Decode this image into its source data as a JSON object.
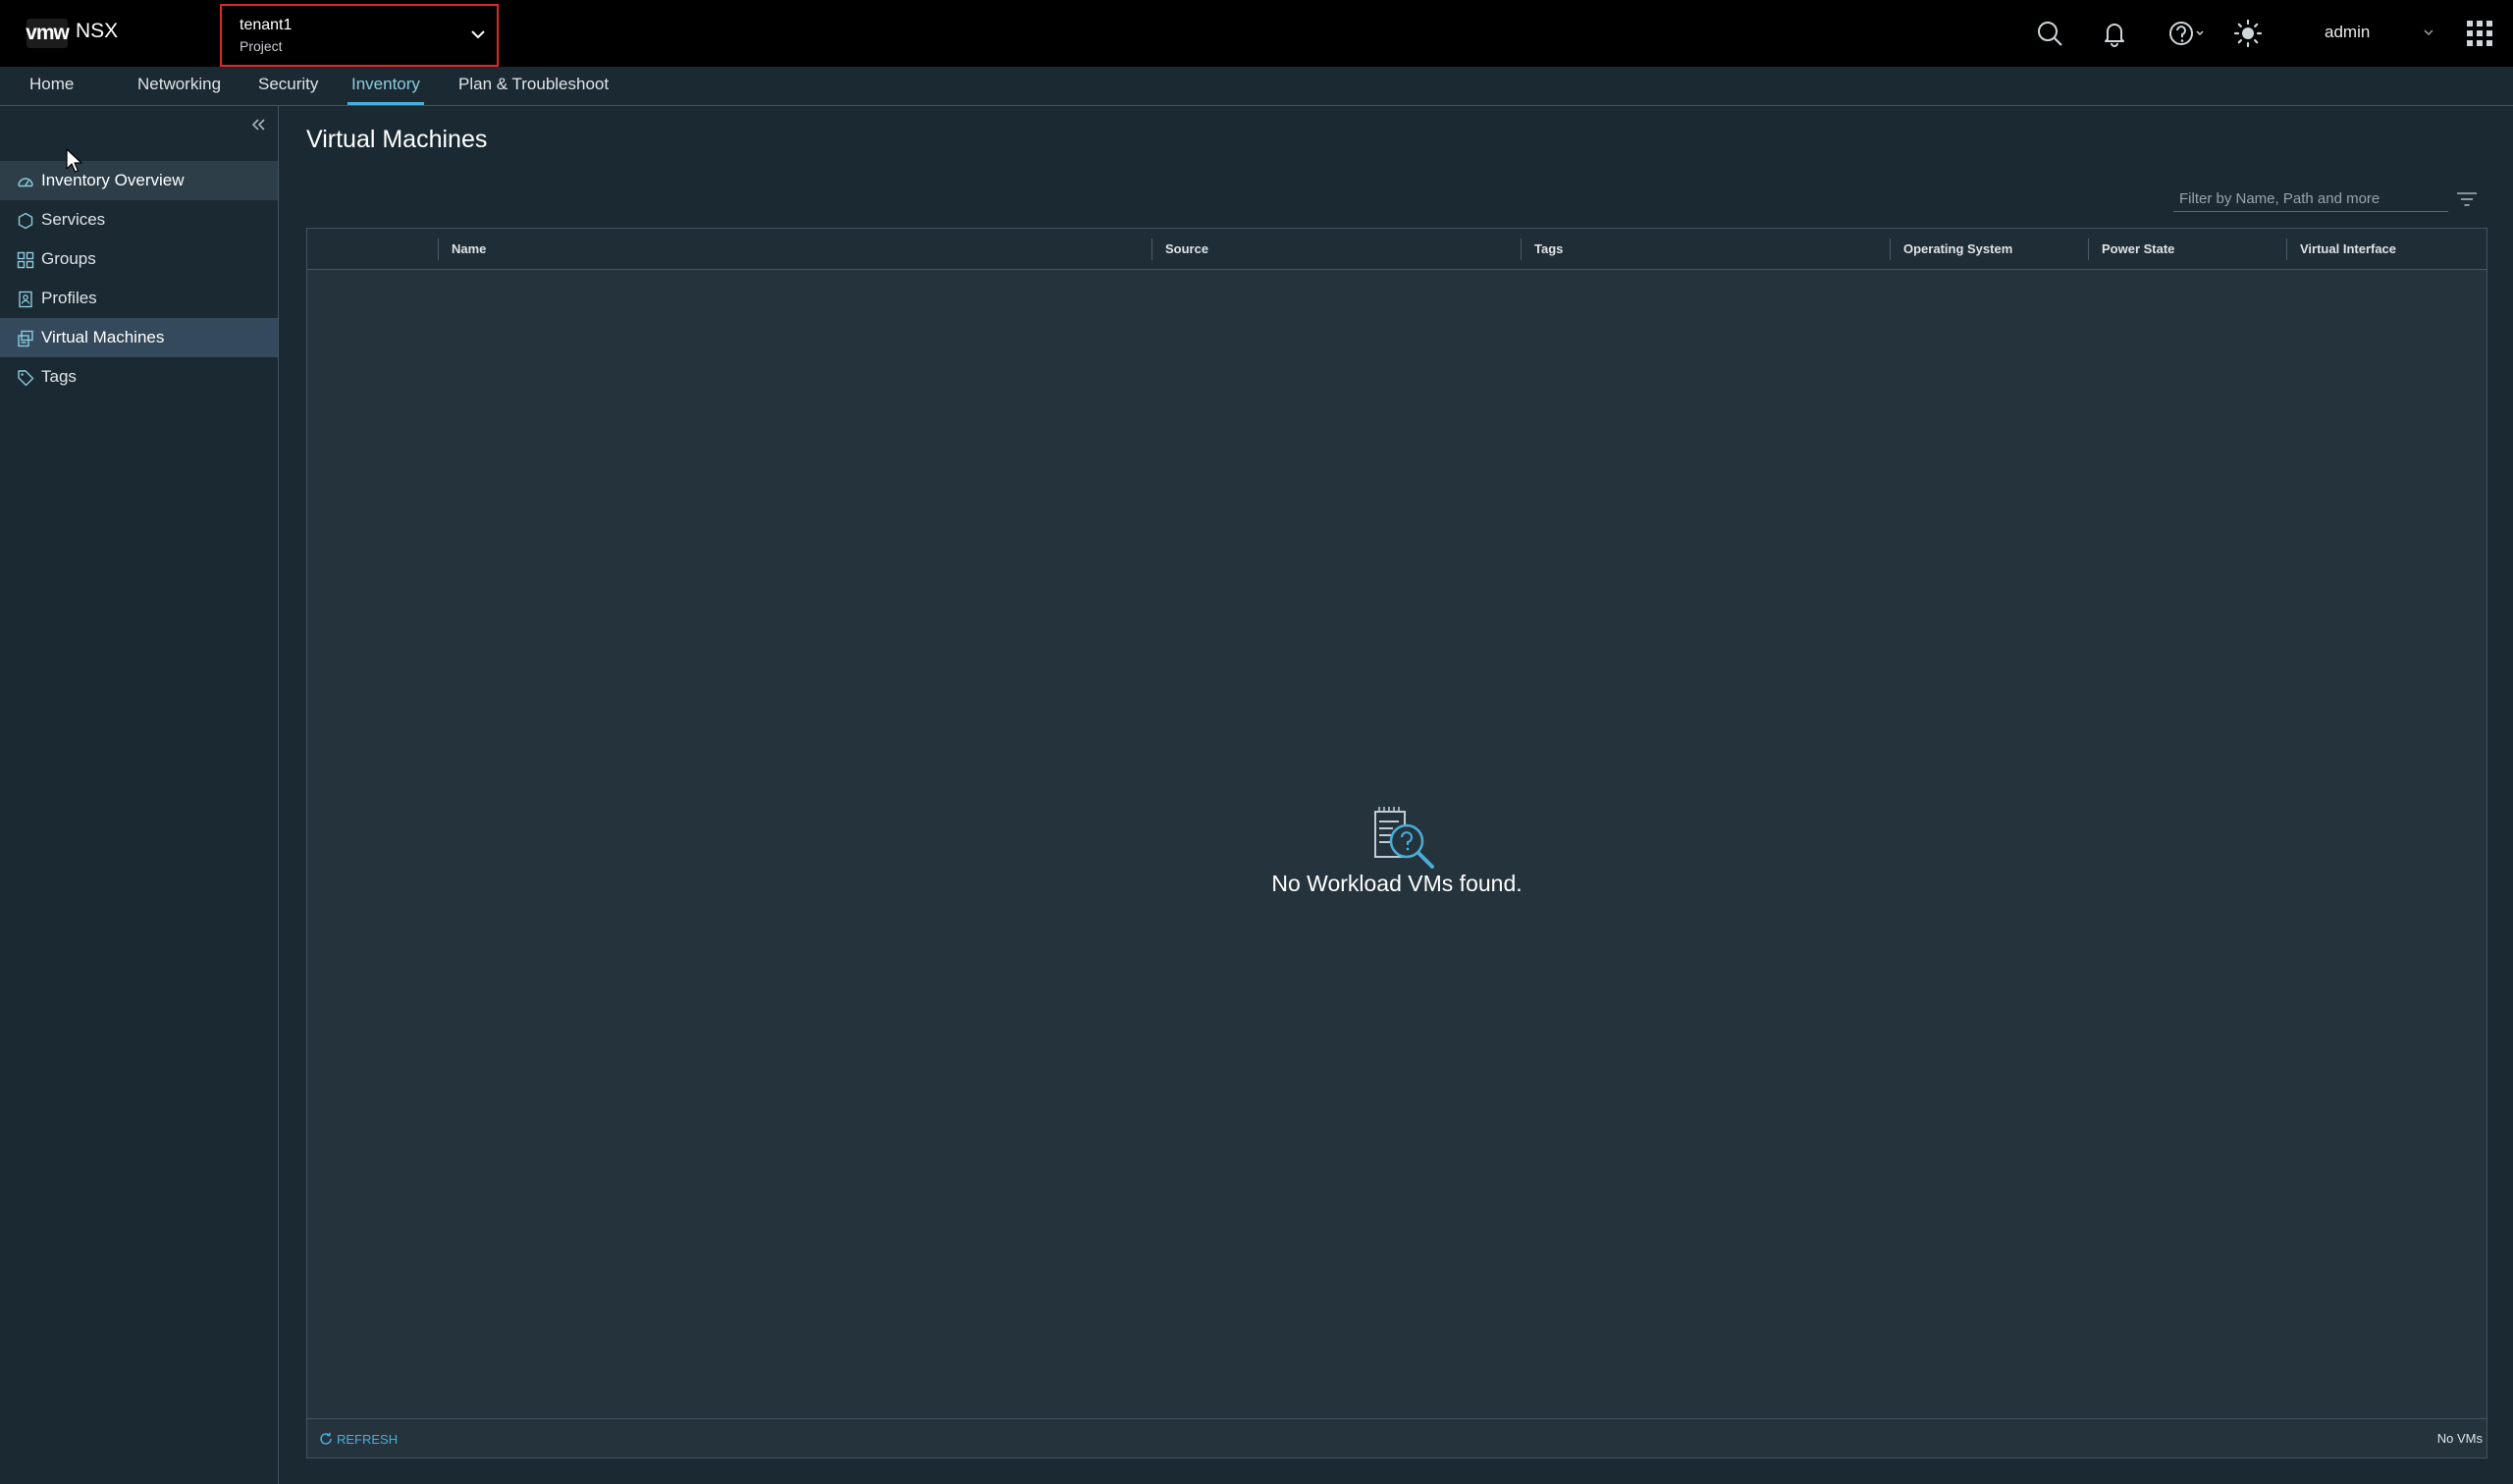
{
  "header": {
    "logo": "vmw",
    "product": "NSX",
    "project": {
      "name": "tenant1",
      "type": "Project"
    },
    "icons": [
      "search-icon",
      "bell-icon",
      "help-icon",
      "theme-sun-icon",
      "apps-grid-icon"
    ],
    "user": "admin"
  },
  "nav": {
    "tabs": [
      {
        "label": "Home"
      },
      {
        "label": "Networking"
      },
      {
        "label": "Security"
      },
      {
        "label": "Inventory",
        "active": true
      },
      {
        "label": "Plan & Troubleshoot"
      }
    ]
  },
  "sidebar": {
    "items": [
      {
        "label": "Inventory Overview",
        "icon": "dashboard-icon"
      },
      {
        "label": "Services",
        "icon": "services-icon"
      },
      {
        "label": "Groups",
        "icon": "groups-icon"
      },
      {
        "label": "Profiles",
        "icon": "profiles-icon"
      },
      {
        "label": "Virtual Machines",
        "icon": "vm-icon",
        "active": true
      },
      {
        "label": "Tags",
        "icon": "tag-icon"
      }
    ]
  },
  "main": {
    "title": "Virtual Machines",
    "filter_placeholder": "Filter by Name, Path and more",
    "columns": [
      "Name",
      "Source",
      "Tags",
      "Operating System",
      "Power State",
      "Virtual Interface"
    ],
    "empty_message": "No Workload VMs found.",
    "refresh_label": "REFRESH",
    "count_label": "No VMs"
  },
  "colors": {
    "accent": "#49afd9",
    "background": "#1b2a32",
    "header": "#000000",
    "highlight_border": "#e02727"
  }
}
